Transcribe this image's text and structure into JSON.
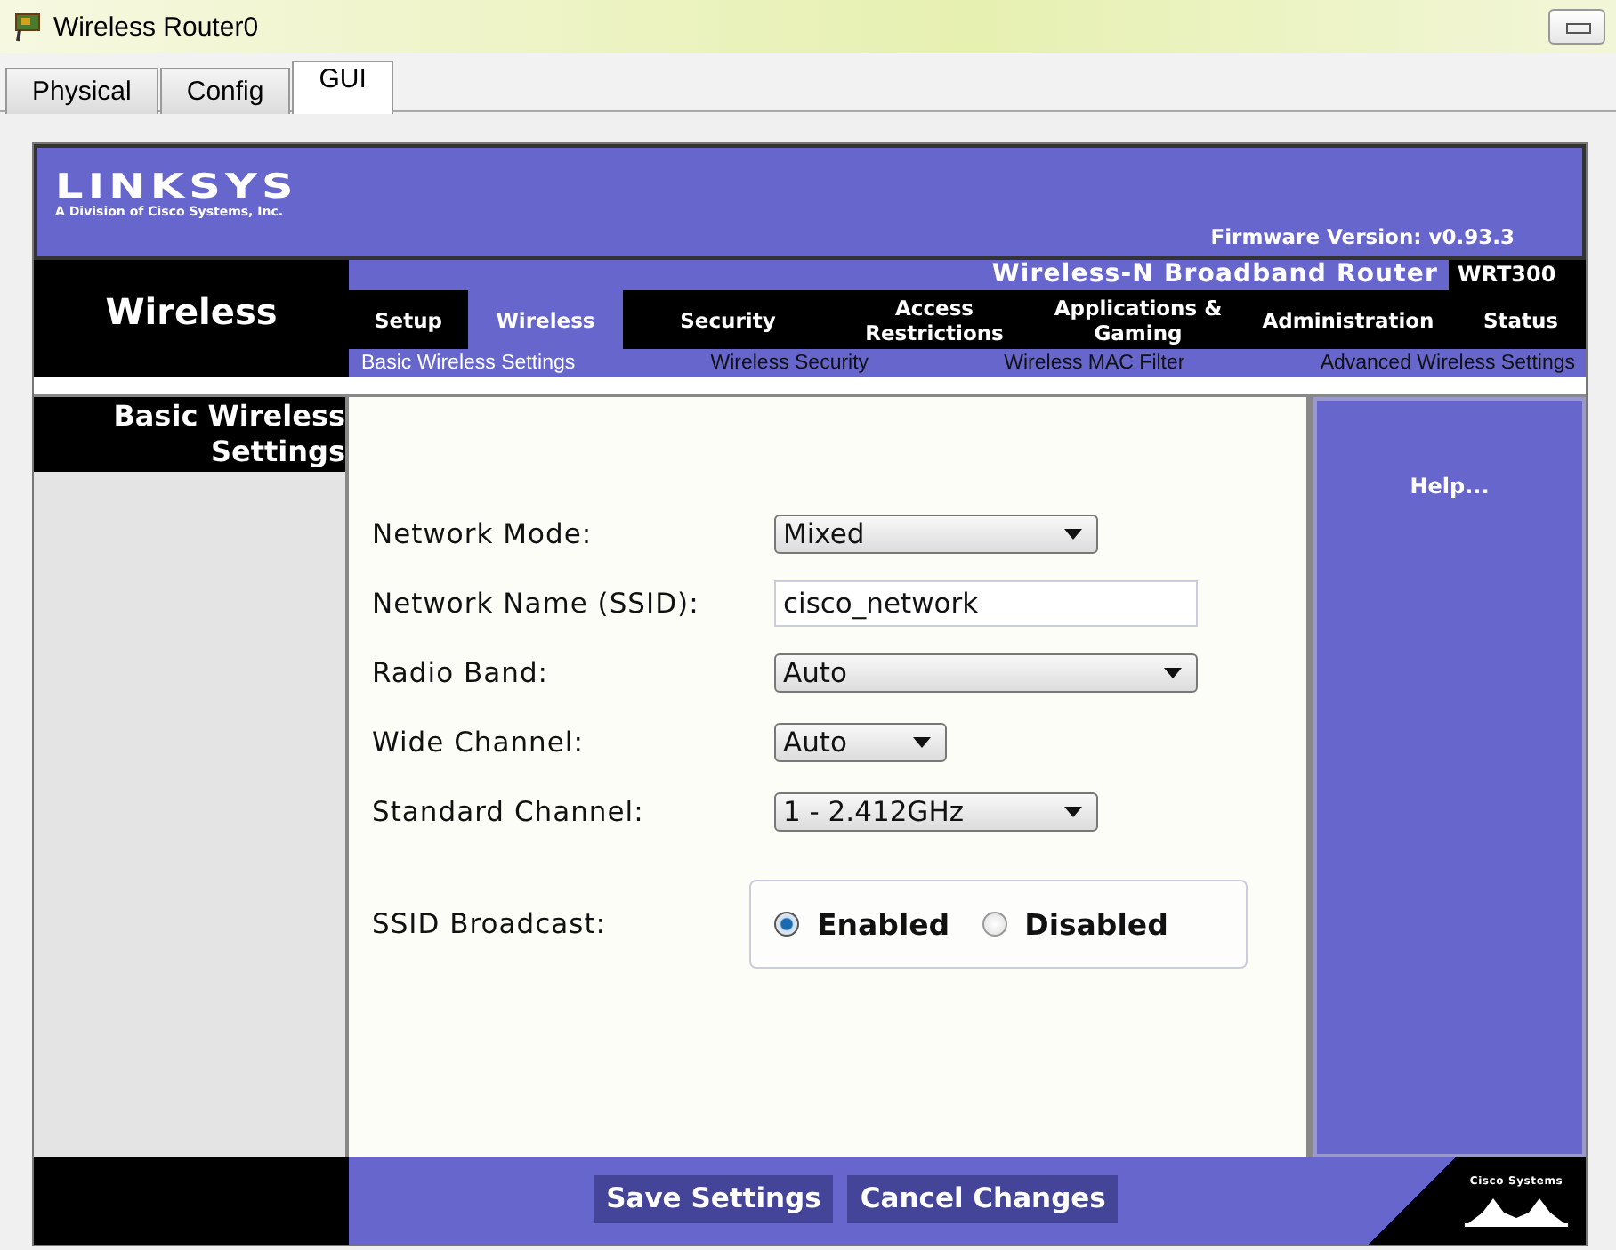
{
  "window": {
    "title": "Wireless Router0"
  },
  "tabs": [
    {
      "label": "Physical",
      "selected": false
    },
    {
      "label": "Config",
      "selected": false
    },
    {
      "label": "GUI",
      "selected": true
    }
  ],
  "router": {
    "brand": "LINKSYS",
    "brand_subtitle": "A Division of Cisco Systems, Inc.",
    "firmware": "Firmware Version: v0.93.3",
    "product": "Wireless-N Broadband Router",
    "model": "WRT300",
    "section": "Wireless",
    "nav": [
      {
        "label": "Setup",
        "selected": false
      },
      {
        "label": "Wireless",
        "selected": true
      },
      {
        "label": "Security",
        "selected": false
      },
      {
        "label": "Access Restrictions",
        "selected": false
      },
      {
        "label": "Applications & Gaming",
        "selected": false
      },
      {
        "label": "Administration",
        "selected": false
      },
      {
        "label": "Status",
        "selected": false
      }
    ],
    "subnav": [
      {
        "label": "Basic Wireless Settings",
        "selected": true
      },
      {
        "label": "Wireless Security",
        "selected": false
      },
      {
        "label": "Wireless MAC Filter",
        "selected": false
      },
      {
        "label": "Advanced Wireless Settings",
        "selected": false
      }
    ],
    "page_title": "Basic Wireless Settings",
    "fields": [
      {
        "kind": "select",
        "label": "Network Mode:",
        "value": "Mixed"
      },
      {
        "kind": "text",
        "label": "Network Name (SSID):",
        "value": "cisco_network"
      },
      {
        "kind": "select",
        "label": "Radio Band:",
        "value": "Auto"
      },
      {
        "kind": "select",
        "label": "Wide Channel:",
        "value": "Auto"
      },
      {
        "kind": "select",
        "label": "Standard Channel:",
        "value": "1 - 2.412GHz"
      }
    ],
    "ssid_broadcast": {
      "label": "SSID Broadcast:",
      "options": [
        {
          "label": "Enabled",
          "selected": true
        },
        {
          "label": "Disabled",
          "selected": false
        }
      ]
    },
    "help": "Help...",
    "buttons": [
      "Save Settings",
      "Cancel Changes"
    ],
    "footer_logo": "Cisco Systems"
  }
}
